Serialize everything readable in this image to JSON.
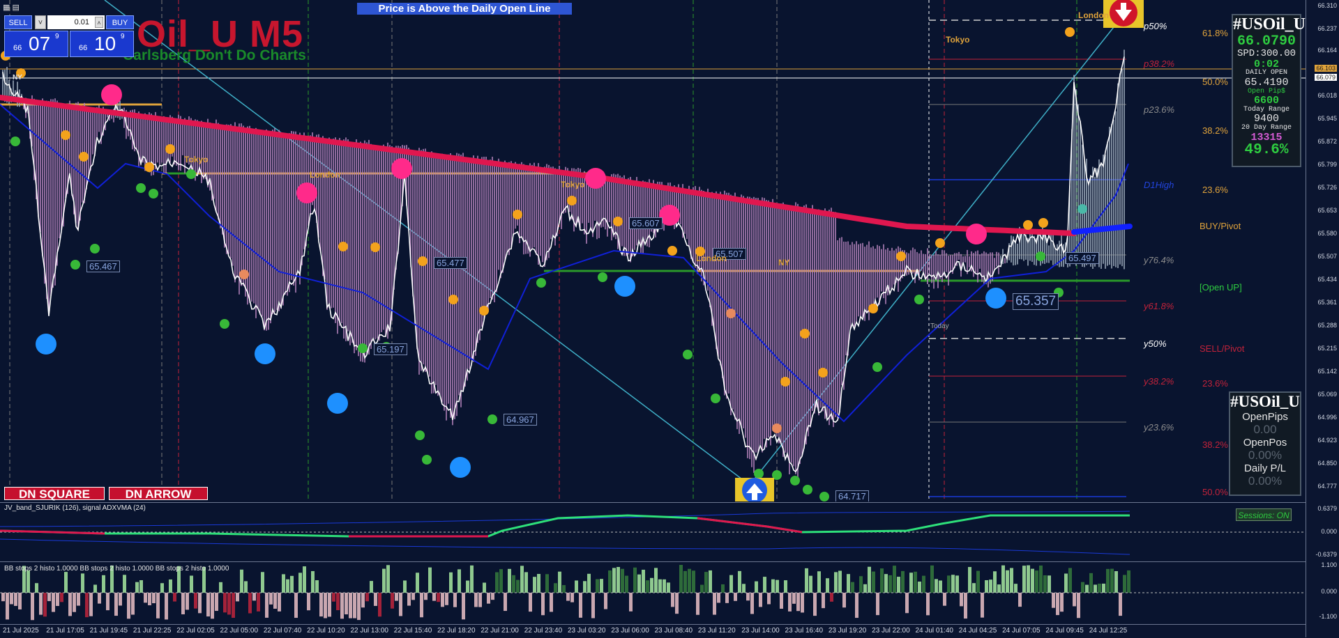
{
  "banner": "Price is Above the Daily Open Line",
  "chart": {
    "title": "Oil_U M5",
    "subtitle": "Carlsberg Don't Do Charts"
  },
  "trade_panel": {
    "sell_label": "SELL",
    "buy_label": "BUY",
    "lot": "0.01",
    "sell_price_small": "66",
    "sell_price_big": "07",
    "sell_price_sup": "9",
    "buy_price_small": "66",
    "buy_price_big": "10",
    "buy_price_sup": "9"
  },
  "buttons": {
    "dn_square": "DN SQUARE",
    "dn_arrow": "DN ARROW",
    "sessions": "Sessions: ON"
  },
  "info_box_1": {
    "symbol": "#USOil_U",
    "price": "66.0790",
    "spread": "SPD:300.00",
    "timer": "0:02",
    "daily_open_label": "DAILY OPEN",
    "daily_open": "65.4190",
    "open_pips_label": "Open Pip$",
    "open_pips": "6600",
    "today_range_label": "Today Range",
    "today_range": "9400",
    "range20_label": "20 Day Range",
    "range20": "13315",
    "pct": "49.6%"
  },
  "info_box_2": {
    "symbol": "#USOil_U",
    "open_pips_label": "OpenPips",
    "open_pips": "0.00",
    "open_pos_label": "OpenPos",
    "open_pos": "0.00%",
    "daily_pl_label": "Daily P/L",
    "daily_pl": "0.00%"
  },
  "fib_left": {
    "p50": "p50%",
    "p382": "p38.2%",
    "p236": "p23.6%",
    "d1high": "D1High",
    "y764": "y76.4%",
    "y618": "y61.8%",
    "y50": "y50%",
    "y382": "y38.2%",
    "y236": "y23.6%"
  },
  "fib_right": {
    "f618": "61.8%",
    "f50": "50.0%",
    "f382": "38.2%",
    "f236": "23.6%",
    "buy_pivot": "BUY/Pivot",
    "open_up": "[Open UP]",
    "sell_pivot": "SELL/Pivot",
    "s236": "23.6%",
    "s382": "38.2%",
    "s50": "50.0%"
  },
  "sessions": {
    "tokyo1": "Tokyo",
    "london1": "London",
    "tokyo2": "Tokyo",
    "london2": "London",
    "ny": "NY",
    "today": "Today",
    "tokyo3": "Tokyo",
    "london3": "London",
    "ny1": "NY"
  },
  "price_labels": [
    "65.467",
    "65.477",
    "65.197",
    "64.967",
    "65.607",
    "65.507",
    "64.717",
    "65.357",
    "65.497"
  ],
  "price_scale": [
    "66.310",
    "66.237",
    "66.164",
    "66.103",
    "66.079",
    "66.018",
    "65.945",
    "65.872",
    "65.799",
    "65.726",
    "65.653",
    "65.580",
    "65.507",
    "65.434",
    "65.361",
    "65.288",
    "65.215",
    "65.142",
    "65.069",
    "64.996",
    "64.923",
    "64.850",
    "64.777"
  ],
  "indicator1": {
    "label": "JV_band_SJURIK (126), signal ADXVMA (24)",
    "scale": [
      "0.6379",
      "0.000",
      "-0.6379"
    ]
  },
  "indicator2": {
    "label": "BB stops 2 histo 1.0000 BB stops 2 histo 1.0000 BB stops 2 histo 1.0000",
    "scale": [
      "1.100",
      "0.000",
      "-1.100"
    ]
  },
  "time_axis": [
    "21 Jul 2025",
    "21 Jul 17:05",
    "21 Jul 19:45",
    "21 Jul 22:25",
    "22 Jul 02:05",
    "22 Jul 05:00",
    "22 Jul 07:40",
    "22 Jul 10:20",
    "22 Jul 13:00",
    "22 Jul 15:40",
    "22 Jul 18:20",
    "22 Jul 21:00",
    "22 Jul 23:40",
    "23 Jul 03:20",
    "23 Jul 06:00",
    "23 Jul 08:40",
    "23 Jul 11:20",
    "23 Jul 14:00",
    "23 Jul 16:40",
    "23 Jul 19:20",
    "23 Jul 22:00",
    "24 Jul 01:40",
    "24 Jul 04:25",
    "24 Jul 07:05",
    "24 Jul 09:45",
    "24 Jul 12:25"
  ],
  "colors": {
    "ma": "#e0174f",
    "bull": "#ffffff",
    "bear": "#b07fb8",
    "up_band": "#1020d8",
    "level": "#e0a33b",
    "open_line": "#2a9a2a",
    "trend": "#3fb0c8",
    "bg": "#09142f"
  }
}
